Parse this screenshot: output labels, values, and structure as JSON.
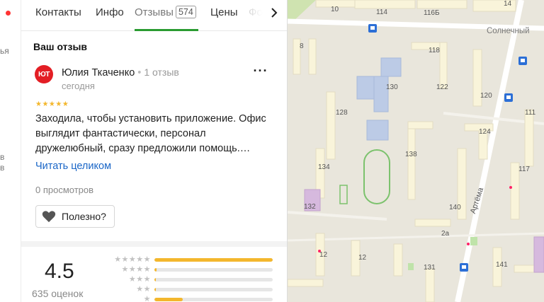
{
  "sidebar": {
    "text1": "ья",
    "text2": "в",
    "text3": "в"
  },
  "tabs": [
    {
      "label": "Контакты"
    },
    {
      "label": "Инфо"
    },
    {
      "label": "Отзывы",
      "badge": "574"
    },
    {
      "label": "Цены"
    },
    {
      "label": "Фо"
    }
  ],
  "review": {
    "section_title": "Ваш отзыв",
    "avatar_initials": "ЮТ",
    "author": "Юлия Ткаченко",
    "author_reviews": "1 отзыв",
    "date": "сегодня",
    "stars": "★★★★★",
    "text": "Заходила, чтобы установить приложение. Офис выглядит фантастически, персонал дружелюбный, сразу предложили помощь.…",
    "read_more": "Читать целиком",
    "views": "0 просмотров",
    "useful_label": "Полезно?"
  },
  "rating": {
    "value": "4.5",
    "count": "635 оценок",
    "distribution": [
      {
        "stars": "★★★★★",
        "fraction": 1.0
      },
      {
        "stars": "★★★★",
        "fraction": 0.02
      },
      {
        "stars": "★★★",
        "fraction": 0.01
      },
      {
        "stars": "★★",
        "fraction": 0.01
      },
      {
        "stars": "★",
        "fraction": 0.24
      }
    ]
  },
  "map": {
    "street_1": "Солнечный",
    "street_2": "Артёма",
    "buildings": [
      "10",
      "114",
      "116Б",
      "14",
      "8",
      "118",
      "130",
      "122",
      "120",
      "128",
      "111",
      "124",
      "134",
      "138",
      "117",
      "132",
      "140",
      "2а",
      "12",
      "141",
      "131",
      "12"
    ]
  },
  "colors": {
    "accent_green": "#2a9b31",
    "link_blue": "#1a66c7",
    "star_yellow": "#f3b72d",
    "avatar_red": "#e31e24"
  }
}
